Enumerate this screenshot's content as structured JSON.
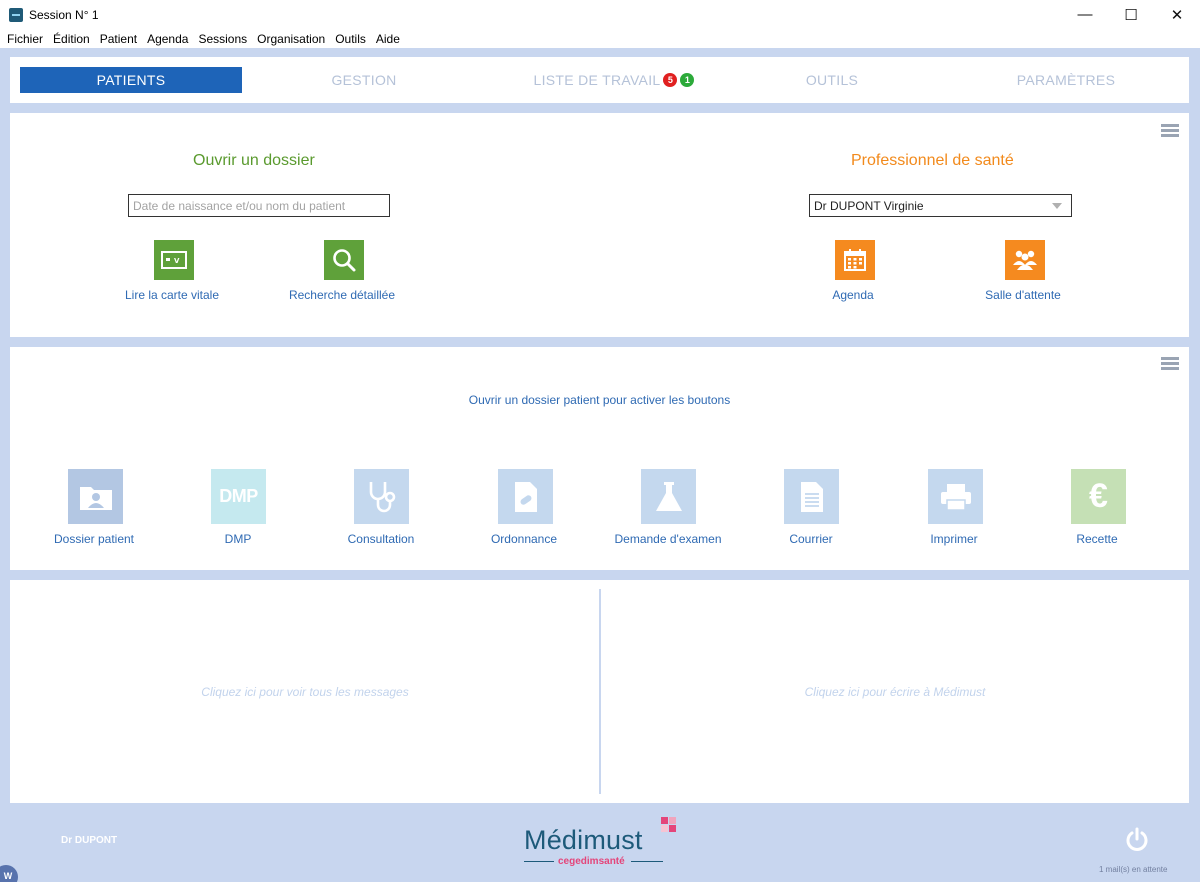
{
  "window": {
    "title": "Session N° 1",
    "minimize": "—",
    "maximize": "☐",
    "close": "✕"
  },
  "menu": [
    "Fichier",
    "Édition",
    "Patient",
    "Agenda",
    "Sessions",
    "Organisation",
    "Outils",
    "Aide"
  ],
  "tabs": {
    "patients": "PATIENTS",
    "gestion": "GESTION",
    "liste": "LISTE DE TRAVAIL",
    "liste_badge_red": "5",
    "liste_badge_green": "1",
    "outils": "OUTILS",
    "parametres": "PARAMÈTRES"
  },
  "open_file": {
    "title": "Ouvrir un dossier",
    "search_placeholder": "Date de naissance et/ou nom du patient",
    "carte_vitale": "Lire la carte vitale",
    "recherche": "Recherche détaillée",
    "carte_glyph": "▪ V"
  },
  "professional": {
    "title": "Professionnel de santé",
    "selected": "Dr DUPONT Virginie",
    "agenda": "Agenda",
    "salle": "Salle d'attente"
  },
  "actions": {
    "hint": "Ouvrir un dossier patient pour activer les boutons",
    "items": [
      {
        "label": "Dossier patient",
        "icon": "folder-user-icon",
        "color": "#b3c7e3"
      },
      {
        "label": "DMP",
        "icon": "dmp-icon",
        "color": "#c5e9ef",
        "glyph": "DMP"
      },
      {
        "label": "Consultation",
        "icon": "stethoscope-icon",
        "color": "#c4d8ee"
      },
      {
        "label": "Ordonnance",
        "icon": "prescription-icon",
        "color": "#c4d8ee"
      },
      {
        "label": "Demande d'examen",
        "icon": "flask-icon",
        "color": "#c4d8ee"
      },
      {
        "label": "Courrier",
        "icon": "letter-icon",
        "color": "#c4d8ee"
      },
      {
        "label": "Imprimer",
        "icon": "printer-icon",
        "color": "#c4d8ee"
      },
      {
        "label": "Recette",
        "icon": "euro-icon",
        "color": "#c5e0b5",
        "glyph": "€"
      }
    ]
  },
  "messages": {
    "left": "Cliquez ici pour voir tous les messages",
    "right": "Cliquez ici pour écrire à Médimust"
  },
  "footer": {
    "user": "Dr DUPONT",
    "logo": "Médimust",
    "logo_sub": "cegedimsanté",
    "mail_status": "1 mail(s) en attente",
    "corner_glyph": "W"
  },
  "colors": {
    "accent": "#1e64b8",
    "green_title": "#5a9a2e",
    "orange_title": "#f28a1c",
    "green_tile": "#5fa13a",
    "orange_tile": "#f58a1f",
    "link": "#2f6ab3"
  }
}
